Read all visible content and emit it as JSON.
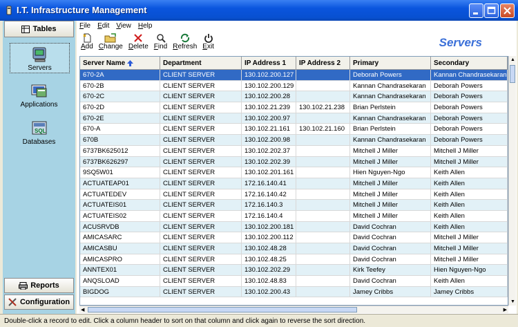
{
  "window": {
    "title": "I.T. Infrastructure Management"
  },
  "nav": {
    "tables": "Tables",
    "items": [
      {
        "label": "Servers",
        "icon": "server-icon",
        "selected": true
      },
      {
        "label": "Applications",
        "icon": "applications-icon",
        "selected": false
      },
      {
        "label": "Databases",
        "icon": "databases-icon",
        "selected": false
      }
    ],
    "reports": "Reports",
    "configuration": "Configuration"
  },
  "menu": [
    "File",
    "Edit",
    "View",
    "Help"
  ],
  "toolbar": [
    {
      "label": "Add",
      "icon": "add-icon"
    },
    {
      "label": "Change",
      "icon": "change-icon"
    },
    {
      "label": "Delete",
      "icon": "delete-icon"
    },
    {
      "label": "Find",
      "icon": "find-icon"
    },
    {
      "label": "Refresh",
      "icon": "refresh-icon"
    },
    {
      "label": "Exit",
      "icon": "exit-icon"
    }
  ],
  "panel_title": "Servers",
  "table": {
    "columns": [
      "Server Name",
      "Department",
      "IP Address 1",
      "IP Address 2",
      "Primary",
      "Secondary"
    ],
    "sort_column": "Server Name",
    "rows": [
      [
        "670-2A",
        "CLIENT SERVER",
        "130.102.200.127",
        "",
        "Deborah Powers",
        "Kannan Chandrasekaran"
      ],
      [
        "670-2B",
        "CLIENT SERVER",
        "130.102.200.129",
        "",
        "Kannan Chandrasekaran",
        "Deborah Powers"
      ],
      [
        "670-2C",
        "CLIENT SERVER",
        "130.102.200.28",
        "",
        "Kannan Chandrasekaran",
        "Deborah Powers"
      ],
      [
        "670-2D",
        "CLIENT SERVER",
        "130.102.21.239",
        "130.102.21.238",
        "Brian Perlstein",
        "Deborah Powers"
      ],
      [
        "670-2E",
        "CLIENT SERVER",
        "130.102.200.97",
        "",
        "Kannan Chandrasekaran",
        "Deborah Powers"
      ],
      [
        "670-A",
        "CLIENT SERVER",
        "130.102.21.161",
        "130.102.21.160",
        "Brian Perlstein",
        "Deborah Powers"
      ],
      [
        "670B",
        "CLIENT SERVER",
        "130.102.200.98",
        "",
        "Kannan Chandrasekaran",
        "Deborah Powers"
      ],
      [
        "6737BK625012",
        "CLIENT SERVER",
        "130.102.202.37",
        "",
        "Mitchell J Miller",
        "Mitchell J Miller"
      ],
      [
        "6737BK626297",
        "CLIENT SERVER",
        "130.102.202.39",
        "",
        "Mitchell J Miller",
        "Mitchell J Miller"
      ],
      [
        "9SQ5W01",
        "CLIENT SERVER",
        "130.102.201.161",
        "",
        "Hien Nguyen-Ngo",
        "Keith Allen"
      ],
      [
        "ACTUATEAP01",
        "CLIENT SERVER",
        "172.16.140.41",
        "",
        "Mitchell J Miller",
        "Keith Allen"
      ],
      [
        "ACTUATEDEV",
        "CLIENT SERVER",
        "172.16.140.42",
        "",
        "Mitchell J Miller",
        "Keith Allen"
      ],
      [
        "ACTUATEIS01",
        "CLIENT SERVER",
        "172.16.140.3",
        "",
        "Mitchell J Miller",
        "Keith Allen"
      ],
      [
        "ACTUATEIS02",
        "CLIENT SERVER",
        "172.16.140.4",
        "",
        "Mitchell J Miller",
        "Keith Allen"
      ],
      [
        "ACUSRVDB",
        "CLIENT SERVER",
        "130.102.200.181",
        "",
        "David Cochran",
        "Keith Allen"
      ],
      [
        "AMICASARC",
        "CLIENT SERVER",
        "130.102.200.112",
        "",
        "David Cochran",
        "Mitchell J Miller"
      ],
      [
        "AMICASBU",
        "CLIENT SERVER",
        "130.102.48.28",
        "",
        "David Cochran",
        "Mitchell J Miller"
      ],
      [
        "AMICASPRO",
        "CLIENT SERVER",
        "130.102.48.25",
        "",
        "David Cochran",
        "Mitchell J Miller"
      ],
      [
        "ANNTEX01",
        "CLIENT SERVER",
        "130.102.202.29",
        "",
        "Kirk Teefey",
        "Hien Nguyen-Ngo"
      ],
      [
        "ANQSLOAD",
        "CLIENT SERVER",
        "130.102.48.83",
        "",
        "David Cochran",
        "Keith Allen"
      ],
      [
        "BIGDOG",
        "CLIENT SERVER",
        "130.102.200.43",
        "",
        "Jamey Cribbs",
        "Jamey Cribbs"
      ]
    ]
  },
  "status": "Double-click a record to edit.  Click a column header to sort on that column and click again to reverse the sort direction."
}
